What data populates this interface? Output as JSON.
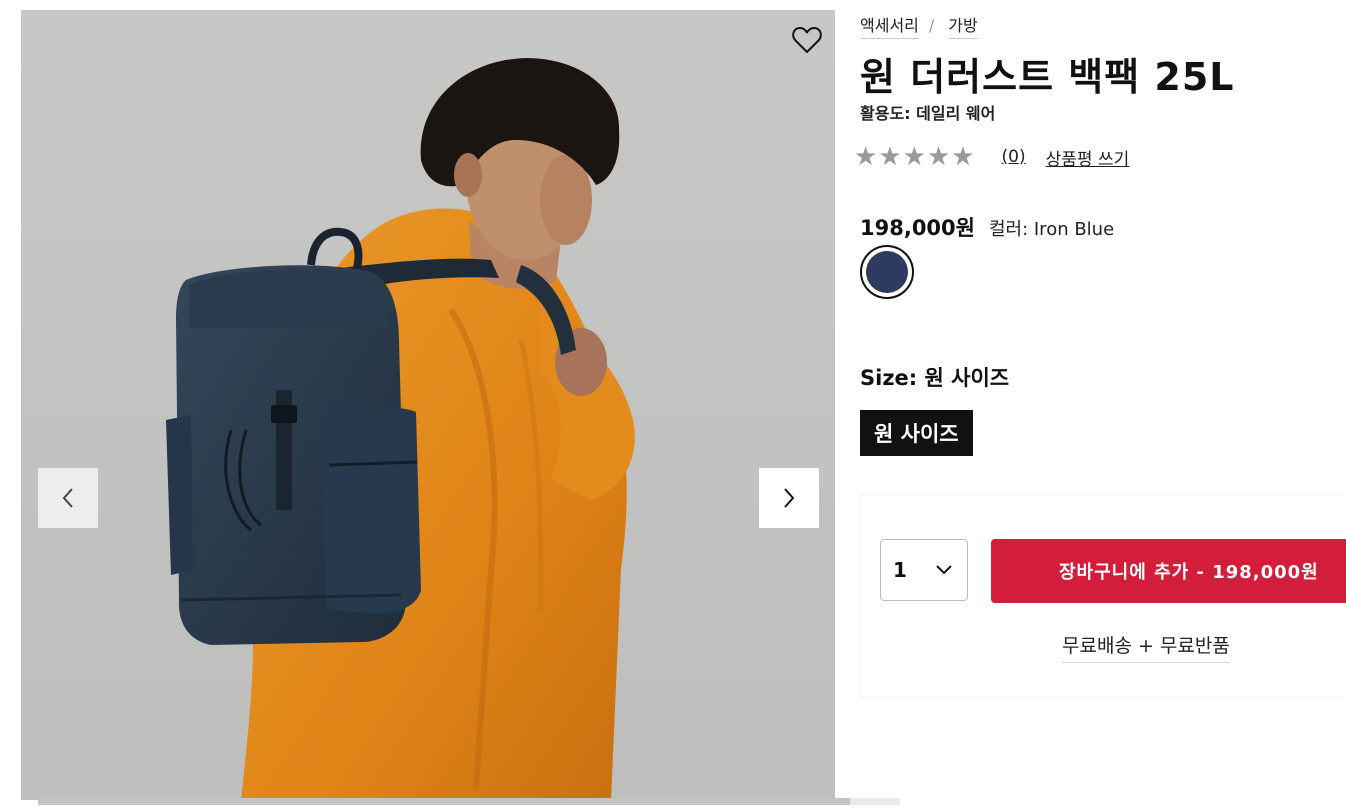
{
  "breadcrumb": {
    "items": [
      "액세서리",
      "가방"
    ],
    "separator": "/"
  },
  "product": {
    "title": "원 더러스트 백팩 25L",
    "activity": "활용도: 데일리 웨어",
    "rating": {
      "stars": "★★★★★",
      "score": 0,
      "review_count": "(0)",
      "write_review": "상품평 쓰기"
    },
    "price": "198,000원",
    "color_label": "컬러: Iron Blue",
    "swatch_color": "#2e3b61",
    "size_label": "Size: 원 사이즈",
    "size_option": "원 사이즈"
  },
  "cart": {
    "quantity": "1",
    "add_button": "장바구니에 추가 - 198,000원",
    "shipping_text": "무료배송 + 무료반품"
  },
  "gallery": {
    "image_alt": "원 더러스트 백팩 25L",
    "prev_icon": "chevron-left-icon",
    "next_icon": "chevron-right-icon",
    "wishlist_icon": "heart-icon"
  },
  "colors": {
    "accent": "#d21e3a",
    "jacket": "#e48c1f",
    "backpack": "#2c3c4e",
    "background": "#c6c7c5"
  }
}
